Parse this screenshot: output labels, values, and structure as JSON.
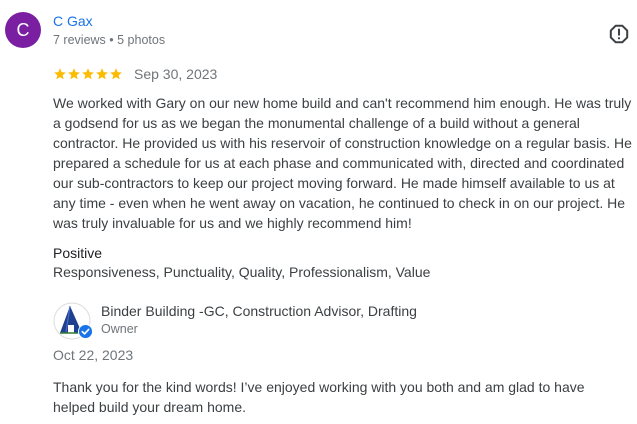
{
  "review": {
    "reviewer": {
      "avatar_letter": "C",
      "avatar_color": "#7b1fa2",
      "name": "C Gax",
      "meta": "7 reviews • 5 photos"
    },
    "report_icon": "report-flag-icon",
    "rating": 5,
    "rating_max": 5,
    "date": "Sep 30, 2023",
    "text": "We worked with Gary on our new home build and can't recommend him enough. He was truly a godsend for us as we began the monumental challenge of a build without a general contractor. He provided us with his reservoir of construction knowledge on a regular basis. He prepared a schedule for us at each phase and communicated with, directed and coordinated our sub-contractors to keep our project moving forward. He made himself available to us at any time - even when he went away on vacation, he continued to check in on our project. He was truly invaluable for us and we highly recommend him!",
    "positive": {
      "heading": "Positive",
      "values": "Responsiveness, Punctuality, Quality, Professionalism, Value"
    }
  },
  "owner_response": {
    "name": "Binder Building -GC, Construction Advisor, Drafting",
    "role": "Owner",
    "logo_icon": "business-logo-icon",
    "verified_icon": "verified-check-icon",
    "date": "Oct 22, 2023",
    "text": "Thank you for the kind words! I’ve enjoyed working with you both and am glad to have helped build your dream home."
  },
  "colors": {
    "link_blue": "#1a73e8",
    "star_gold": "#fbbc04",
    "muted_text": "#70757a",
    "body_text": "#3c4043",
    "logo_navy": "#1f3f8f",
    "verified_blue": "#1a73e8"
  }
}
